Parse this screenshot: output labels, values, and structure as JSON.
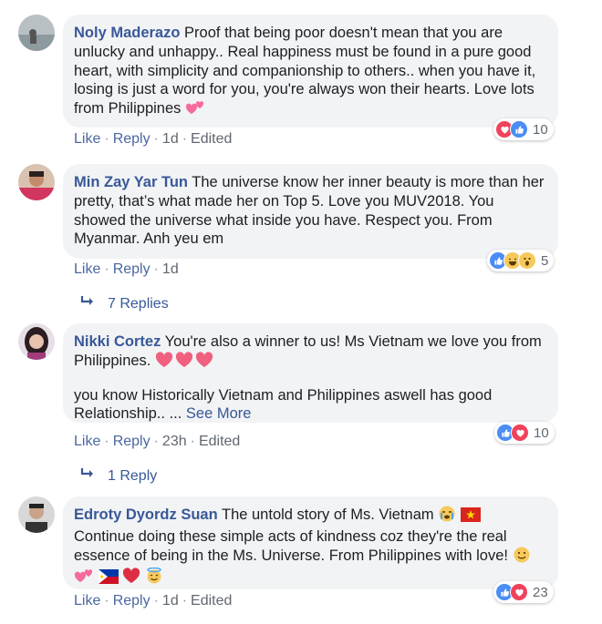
{
  "comments": [
    {
      "name": "Noly Maderazo",
      "text": "Proof that being poor doesn't mean that you are unlucky and unhappy.. Real happiness must be found in a pure good heart, with simplicity and companionship to others.. when you have it, losing is just a word for you, you're always won their hearts. Love lots from Philippines",
      "like": "Like",
      "reply": "Reply",
      "time": "1d",
      "edited": "Edited",
      "reaction_count": "10",
      "reaction_icons": [
        "love-icon",
        "like-icon"
      ]
    },
    {
      "name": "Min Zay Yar Tun",
      "text": "The universe know her inner beauty is more than her pretty, that’s what made her on Top 5. Love you MUV2018. You showed the universe what inside you have. Respect you. From Myanmar. Anh yeu em",
      "like": "Like",
      "reply": "Reply",
      "time": "1d",
      "reaction_count": "5",
      "reaction_icons": [
        "like-icon",
        "haha-icon",
        "wow-icon"
      ],
      "replies_label": "7 Replies"
    },
    {
      "name": "Nikki Cortez",
      "text": "You're also a winner to us! Ms Vietnam we love you from Philippines.",
      "text2": "you know Historically Vietnam and Philippines aswell has good Relationship.. ...",
      "see_more": "See More",
      "like": "Like",
      "reply": "Reply",
      "time": "23h",
      "edited": "Edited",
      "reaction_count": "10",
      "reaction_icons": [
        "like-icon",
        "love-icon"
      ],
      "replies_label": "1 Reply"
    },
    {
      "name": "Edroty Dyordz Suan",
      "text": "The untold story of Ms. Vietnam",
      "text2": "Continue doing these simple acts of kindness coz they're the real essence of being in the Ms. Universe. From Philippines with love!",
      "like": "Like",
      "reply": "Reply",
      "time": "1d",
      "edited": "Edited",
      "reaction_count": "23",
      "reaction_icons": [
        "like-icon",
        "love-icon"
      ]
    }
  ],
  "colors": {
    "name": "#385898",
    "bubble": "#f2f3f5",
    "action_text": "#606770",
    "like_blue": "#4a8df5",
    "love_red": "#f0425b"
  }
}
